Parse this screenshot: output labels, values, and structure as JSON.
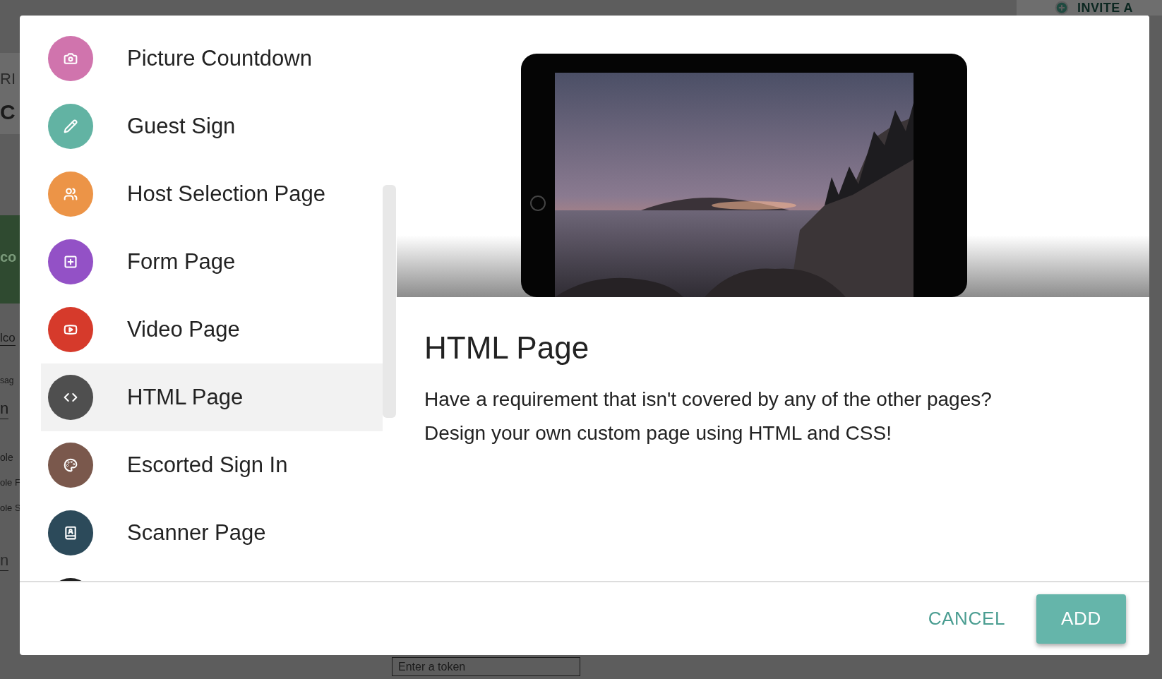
{
  "background": {
    "header_action": "INVITE A",
    "fragments": [
      {
        "text": "RI",
        "kind": "caption"
      },
      {
        "text": "C",
        "kind": "heading"
      },
      {
        "text": "co",
        "kind": "banner"
      },
      {
        "text": "lco",
        "kind": "field"
      },
      {
        "text": "sag",
        "kind": "caption"
      },
      {
        "text": "n",
        "kind": "field"
      },
      {
        "text": "ole",
        "kind": "caption"
      },
      {
        "text": "ole F",
        "kind": "caption"
      },
      {
        "text": "ole S",
        "kind": "caption"
      },
      {
        "text": "n",
        "kind": "field"
      }
    ],
    "token_field": {
      "placeholder": "Enter a token"
    }
  },
  "dialog": {
    "page_types": [
      {
        "label": "Picture Countdown",
        "color": "#d074ad",
        "selected": false
      },
      {
        "label": "Guest Sign",
        "color": "#62b3a3",
        "selected": false
      },
      {
        "label": "Host Selection Page",
        "color": "#ec9447",
        "selected": false
      },
      {
        "label": "Form Page",
        "color": "#9351c6",
        "selected": false
      },
      {
        "label": "Video Page",
        "color": "#d63a2b",
        "selected": false
      },
      {
        "label": "HTML Page",
        "color": "#4f4f4f",
        "selected": true
      },
      {
        "label": "Escorted Sign In",
        "color": "#7a584c",
        "selected": false
      },
      {
        "label": "Scanner Page",
        "color": "#2c4a5a",
        "selected": false
      },
      {
        "color": "#1f1f1f",
        "selected": false
      }
    ],
    "detail": {
      "title": "HTML Page",
      "description": "Have a requirement that isn't covered by any of the other pages? Design your own custom page using HTML and CSS!"
    },
    "buttons": [
      {
        "label": "CANCEL",
        "kind": "text"
      },
      {
        "label": "ADD",
        "kind": "primary"
      }
    ]
  }
}
